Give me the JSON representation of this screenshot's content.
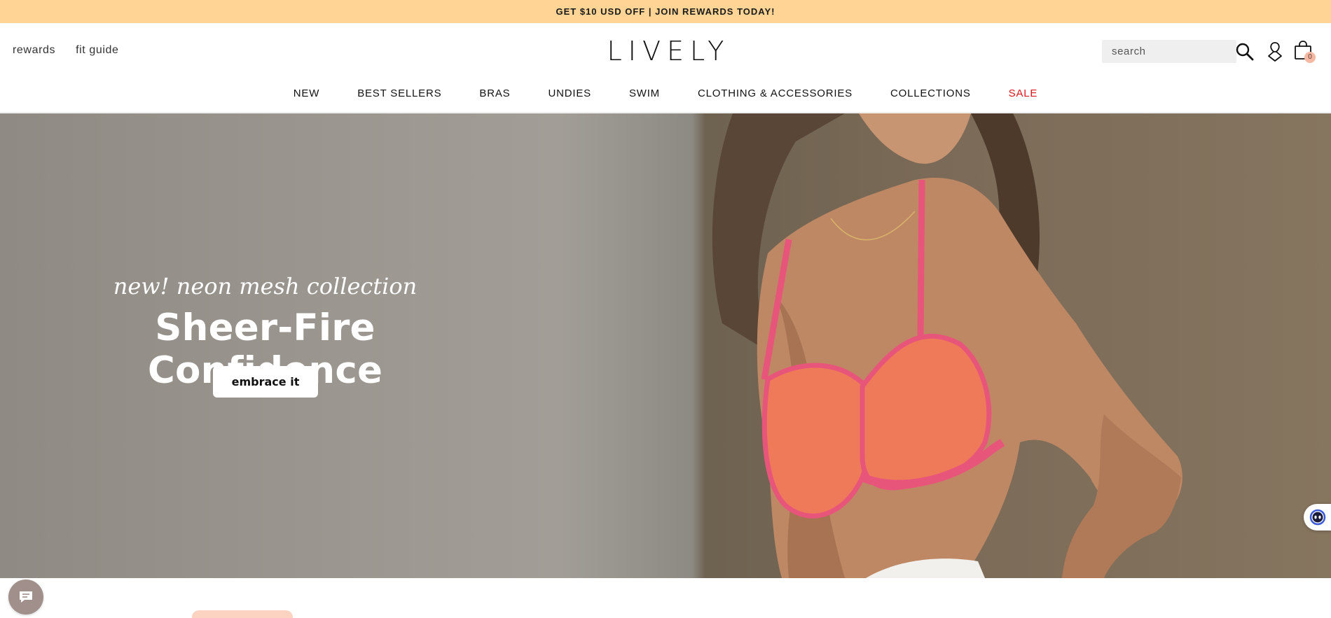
{
  "promo": {
    "text": "GET $10 USD OFF | JOIN REWARDS TODAY!"
  },
  "header": {
    "util_links": [
      "rewards",
      "fit guide"
    ],
    "logo": "LIVELY",
    "search": {
      "placeholder": "search",
      "value": ""
    },
    "cart_count": "0"
  },
  "nav": {
    "items": [
      "NEW",
      "BEST SELLERS",
      "BRAS",
      "UNDIES",
      "SWIM",
      "CLOTHING & ACCESSORIES",
      "COLLECTIONS",
      "SALE"
    ],
    "sale_color": "#e0141e"
  },
  "hero": {
    "eyebrow": "new! neon mesh collection",
    "title": "Sheer-Fire Confidence",
    "cta": "embrace it"
  },
  "colors": {
    "promo_bg": "#ffd495",
    "cart_badge": "#f5b8a3",
    "chat_bubble": "#a08f8a",
    "bra_coral": "#ef7a5a",
    "bra_pink": "#e8557a"
  },
  "icons": [
    "search-icon",
    "account-icon",
    "cart-icon",
    "ai-assistant-icon",
    "chat-icon"
  ]
}
